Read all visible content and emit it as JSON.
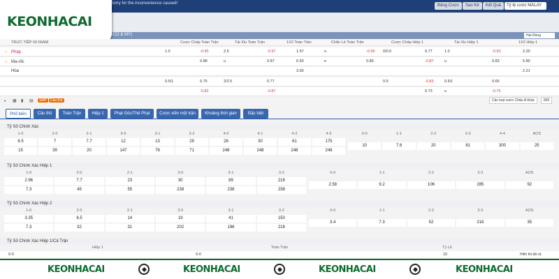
{
  "topbar": {
    "notice": "Please refer to result section for more details. Sorry for the inconvenience caused!",
    "buttons": [
      "Bảng Cược",
      "Sao Kê",
      "Kết Quả"
    ],
    "odds_select": "Tỷ lệ cược MALAY"
  },
  "logo": "KEONHACAI",
  "league": {
    "name": "EXICO & MỸ)",
    "dropdown": "Hai Dòng"
  },
  "match_headers": [
    "Cược Chấp Toàn Trận",
    "Tài Xỉu Toàn Trận",
    "1X2 Toàn Trận",
    "Chẵn Lẻ Toàn Trận",
    "Cược Chấp Hiệp 1",
    "Tài Xỉu Hiệp 1",
    "1X2 Hiệp 1"
  ],
  "time_label": "TRỰC TIẾP 00:00AM",
  "teams": [
    "Pháp",
    "Ma-rốc",
    "Hòa"
  ],
  "odds_rows": [
    [
      "1.0",
      "-0.95",
      "2.5",
      "-0.97",
      "1.57",
      "o",
      "-0.99",
      "0/0.5",
      "0.77",
      "1.0",
      "-0.93",
      "2.20"
    ],
    [
      "",
      "0.88",
      "u",
      "0.87",
      "6.50",
      "e",
      "0.89",
      "",
      "-0.87",
      "u",
      "0.83",
      "5.80"
    ],
    [
      "",
      "",
      "",
      "",
      "3.90",
      "",
      "",
      "",
      "",
      "",
      "",
      "2.21"
    ],
    [
      "0.5/1",
      "0.75",
      "2/2.5",
      "0.77",
      "",
      "",
      "",
      "0.5",
      "-0.83",
      "0.5/1",
      "0.65",
      ""
    ],
    [
      "",
      "-0.82",
      "",
      "-0.87",
      "",
      "",
      "",
      "",
      "0.73",
      "u",
      "-0.75",
      ""
    ]
  ],
  "icon_bar": {
    "smp": "SMP",
    "cau_thu": "Cầu thủ",
    "right_select": "Các loại cược Châu Á khác",
    "count": "820"
  },
  "tabs": [
    "Phổ biến",
    "Cầu thủ",
    "Toàn Trận",
    "Hiệp 1",
    "Phạt Góc/Thẻ Phạt",
    "Cược xiên một trận",
    "Khoảng thời gian",
    "Đặc biệt"
  ],
  "sections": [
    {
      "title": "Tỷ Số Chính Xác",
      "left_labels": [
        "1-0",
        "2-0",
        "2-1",
        "3-0",
        "3-1",
        "3-2",
        "4-0",
        "4-1",
        "4-2",
        "4-3"
      ],
      "left_top": [
        "6.5",
        "7",
        "7.7",
        "12",
        "13",
        "29",
        "28",
        "30",
        "61",
        "175"
      ],
      "left_bottom": [
        "15",
        "39",
        "20",
        "147",
        "76",
        "71",
        "248",
        "248",
        "248",
        "248"
      ],
      "right_labels": [
        "0-0",
        "1-1",
        "2-2",
        "3-3",
        "4-4",
        "AOS"
      ],
      "right_values": [
        "10",
        "7.6",
        "20",
        "81",
        "300",
        "25"
      ]
    },
    {
      "title": "Tỷ Số Chính Xác Hiệp 1",
      "left_labels": [
        "1-0",
        "2-0",
        "2-1",
        "3-0",
        "3-1",
        "3-2"
      ],
      "left_top": [
        "2.96",
        "7.7",
        "23",
        "30",
        "89",
        "218"
      ],
      "left_bottom": [
        "7.3",
        "45",
        "55",
        "238",
        "238",
        "238"
      ],
      "right_labels": [
        "0-0",
        "1-1",
        "2-2",
        "3-3",
        "AOS"
      ],
      "right_values": [
        "2.58",
        "9.2",
        "106",
        "285",
        "92"
      ]
    },
    {
      "title": "Tỷ Số Chính Xác Hiệp 2",
      "left_labels": [
        "1-0",
        "2-0",
        "2-1",
        "3-0",
        "3-1",
        "3-2"
      ],
      "left_top": [
        "3.35",
        "6.5",
        "14",
        "19",
        "41",
        "150"
      ],
      "left_bottom": [
        "7.3",
        "32",
        "31",
        "202",
        "196",
        "218"
      ],
      "right_labels": [
        "0-0",
        "1-1",
        "2-2",
        "3-3",
        "AOS"
      ],
      "right_values": [
        "3.4",
        "7.3",
        "52",
        "218",
        "35"
      ]
    }
  ],
  "htft": {
    "title": "Tỷ Số Chính Xác Hiệp 1/Cả Trận",
    "headers": [
      "Hiệp 1",
      "Toàn Trận",
      "Tỷ Lệ"
    ],
    "row": [
      "0-0",
      "0-0",
      "10"
    ],
    "more": "Hiển thị tất cả"
  },
  "footer_logo": "KEONHACAI"
}
